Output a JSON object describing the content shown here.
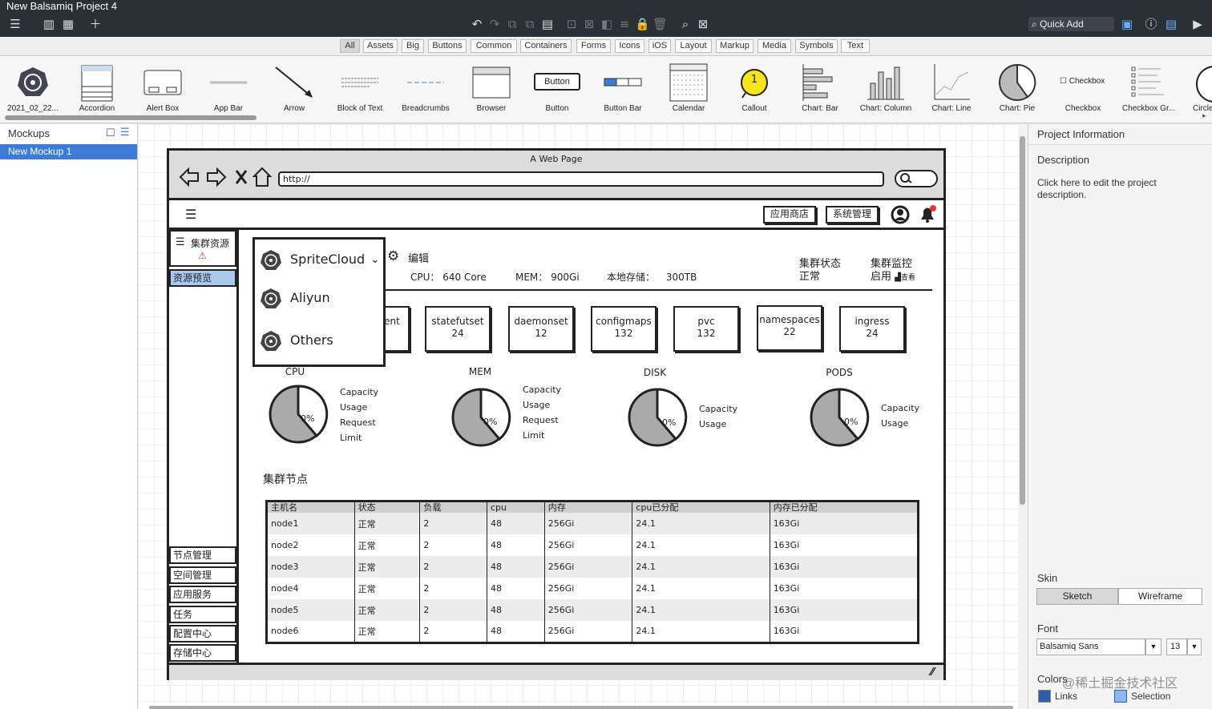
{
  "window": {
    "title": "New Balsamiq Project 4"
  },
  "toolbar": {
    "quick_add": "Quick Add"
  },
  "filters": [
    "All",
    "Assets",
    "Big",
    "Buttons",
    "Common",
    "Containers",
    "Forms",
    "Icons",
    "iOS",
    "Layout",
    "Markup",
    "Media",
    "Symbols",
    "Text"
  ],
  "library": [
    "2021_02_22...",
    "Accordion",
    "Alert Box",
    "App Bar",
    "Arrow",
    "Block of Text",
    "Breadcrumbs",
    "Browser",
    "Button",
    "Button Bar",
    "Calendar",
    "Callout",
    "Chart: Bar",
    "Chart: Column",
    "Chart: Line",
    "Chart: Pie",
    "Checkbox",
    "Checkbox Gr...",
    "Circle"
  ],
  "library_previews": {
    "button": "Button",
    "checkbox": "Checkbox",
    "callout": "1"
  },
  "mockups": {
    "header": "Mockups",
    "items": [
      "New Mockup 1"
    ]
  },
  "right_panel": {
    "title": "Project Information",
    "desc_label": "Description",
    "desc_text": "Click here to edit the project description.",
    "skin_label": "Skin",
    "skin_options": [
      "Sketch",
      "Wireframe"
    ],
    "font_label": "Font",
    "font_value": "Balsamiq Sans",
    "font_size": "13",
    "colors_label": "Colors",
    "links_label": "Links",
    "selection_label": "Selection",
    "watermark": "@稀土掘金技术社区"
  },
  "browser": {
    "title": "A Web Page",
    "url": "http://"
  },
  "app": {
    "top_buttons": [
      "应用商店",
      "系统管理"
    ],
    "sidebar_top": "集群资源",
    "sidebar_selected": "资源预览",
    "sidebar_items": [
      "节点管理",
      "空间管理",
      "应用服务",
      "任务",
      "配置中心",
      "存储中心"
    ],
    "clusters": [
      "SpriteCloud",
      "Aliyun",
      "Others"
    ],
    "edit_label": "编辑",
    "cpu_label": "CPU：",
    "cpu_value": "640 Core",
    "mem_label": "MEM：",
    "mem_value": "900Gi",
    "storage_label": "本地存储：",
    "storage_value": "300TB",
    "status_title": "集群状态",
    "status_value": "正常",
    "monitor_title": "集群监控",
    "monitor_value": "启用",
    "monitor_link": "查看",
    "cards": [
      {
        "name": "ent",
        "value": ""
      },
      {
        "name": "statefutset",
        "value": "24"
      },
      {
        "name": "daemonset",
        "value": "12"
      },
      {
        "name": "configmaps",
        "value": "132"
      },
      {
        "name": "pvc",
        "value": "132"
      },
      {
        "name": "namespaces",
        "value": "22"
      },
      {
        "name": "ingress",
        "value": "24"
      }
    ],
    "pies": [
      {
        "title": "CPU",
        "pct": "0%",
        "legend": [
          "Capacity",
          "Usage",
          "Request",
          "Limit"
        ]
      },
      {
        "title": "MEM",
        "pct": "0%",
        "legend": [
          "Capacity",
          "Usage",
          "Request",
          "Limit"
        ]
      },
      {
        "title": "DISK",
        "pct": "0%",
        "legend": [
          "Capacity",
          "Usage"
        ]
      },
      {
        "title": "PODS",
        "pct": "0%",
        "legend": [
          "Capacity",
          "Usage"
        ]
      }
    ],
    "nodes_title": "集群节点",
    "table": {
      "headers": [
        "主机名",
        "状态",
        "负载",
        "cpu",
        "内存",
        "cpu已分配",
        "内存已分配"
      ],
      "rows": [
        [
          "node1",
          "正常",
          "2",
          "48",
          "256Gi",
          "24.1",
          "163Gi"
        ],
        [
          "node2",
          "正常",
          "2",
          "48",
          "256Gi",
          "24.1",
          "163Gi"
        ],
        [
          "node3",
          "正常",
          "2",
          "48",
          "256Gi",
          "24.1",
          "163Gi"
        ],
        [
          "node4",
          "正常",
          "2",
          "48",
          "256Gi",
          "24.1",
          "163Gi"
        ],
        [
          "node5",
          "正常",
          "2",
          "48",
          "256Gi",
          "24.1",
          "163Gi"
        ],
        [
          "node6",
          "正常",
          "2",
          "48",
          "256Gi",
          "24.1",
          "163Gi"
        ]
      ]
    }
  }
}
